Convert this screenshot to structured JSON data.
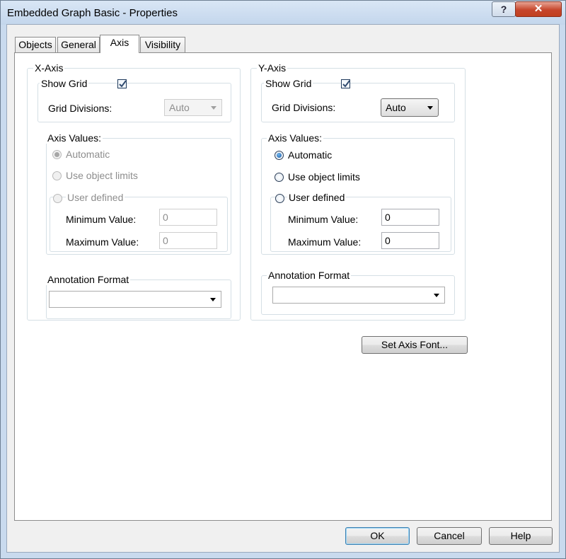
{
  "window": {
    "title": "Embedded Graph Basic - Properties",
    "help_glyph": "?",
    "close_glyph": "✕"
  },
  "tabs": [
    {
      "label": "Objects"
    },
    {
      "label": "General"
    },
    {
      "label": "Axis"
    },
    {
      "label": "Visibility"
    }
  ],
  "x_axis": {
    "title": "X-Axis",
    "show_grid_label": "Show Grid",
    "show_grid_checked": true,
    "grid_divisions_label": "Grid Divisions:",
    "grid_divisions_value": "Auto",
    "axis_values_label": "Axis Values:",
    "automatic_label": "Automatic",
    "use_object_limits_label": "Use object limits",
    "user_defined_label": "User defined",
    "minimum_label": "Minimum Value:",
    "minimum_value": "0",
    "maximum_label": "Maximum Value:",
    "maximum_value": "0",
    "annotation_format_label": "Annotation Format",
    "annotation_format_value": ""
  },
  "y_axis": {
    "title": "Y-Axis",
    "show_grid_label": "Show Grid",
    "show_grid_checked": true,
    "grid_divisions_label": "Grid Divisions:",
    "grid_divisions_value": "Auto",
    "axis_values_label": "Axis Values:",
    "automatic_label": "Automatic",
    "use_object_limits_label": "Use object limits",
    "user_defined_label": "User defined",
    "minimum_label": "Minimum Value:",
    "minimum_value": "0",
    "maximum_label": "Maximum Value:",
    "maximum_value": "0",
    "annotation_format_label": "Annotation Format",
    "annotation_format_value": ""
  },
  "set_axis_font_label": "Set Axis Font...",
  "footer": {
    "ok_label": "OK",
    "cancel_label": "Cancel",
    "help_label": "Help"
  }
}
